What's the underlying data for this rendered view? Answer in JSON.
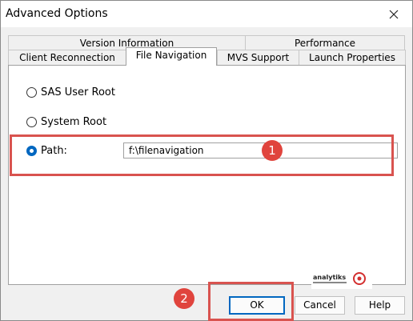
{
  "window": {
    "title": "Advanced Options"
  },
  "tabs": {
    "row_back": [
      "Version Information",
      "Performance"
    ],
    "row_front": [
      "Client Reconnection",
      "File Navigation",
      "MVS Support",
      "Launch Properties"
    ],
    "active": "File Navigation"
  },
  "options": {
    "sas_user_root": {
      "label": "SAS User Root",
      "checked": false
    },
    "system_root": {
      "label": "System Root",
      "checked": false
    },
    "path": {
      "label": "Path:",
      "checked": true,
      "value": "f:\\filenavigation"
    }
  },
  "markers": [
    "1",
    "2"
  ],
  "buttons": {
    "ok": "OK",
    "cancel": "Cancel",
    "help": "Help"
  },
  "logo": {
    "text": "analytiks"
  },
  "colors": {
    "accent": "#0067c0",
    "annotation": "#d9534f"
  }
}
